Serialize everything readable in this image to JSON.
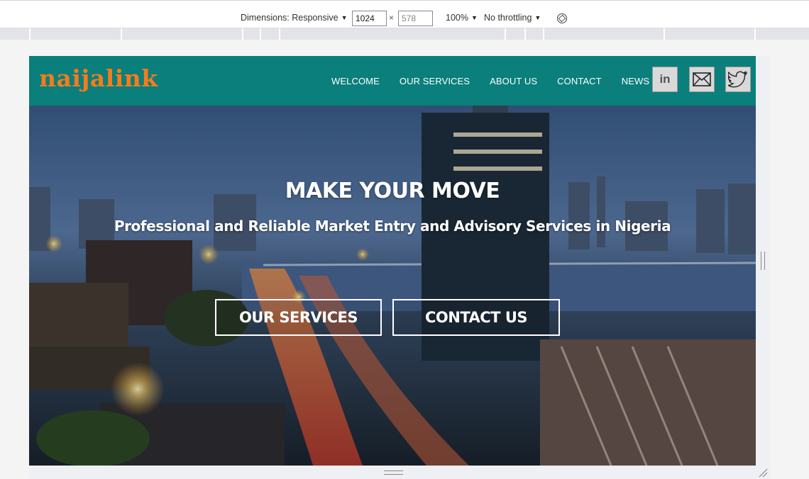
{
  "devtools": {
    "dimensions_label": "Dimensions: Responsive",
    "width_value": "1024",
    "height_value": "578",
    "times": "×",
    "zoom": "100%",
    "throttling": "No throttling",
    "caret": "▼"
  },
  "site": {
    "logo": "naijalink",
    "nav": [
      "WELCOME",
      "OUR SERVICES",
      "ABOUT US",
      "CONTACT",
      "NEWS"
    ],
    "social_icons": [
      "linkedin-icon",
      "email-icon",
      "twitter-icon"
    ],
    "linkedin_label": "in"
  },
  "hero": {
    "title": "MAKE YOUR MOVE",
    "subtitle": "Professional and Reliable Market Entry and Advisory Services in Nigeria",
    "button_services": "OUR SERVICES",
    "button_contact": "CONTACT US"
  },
  "colors": {
    "navbar": "#0b7f7b",
    "logo": "#f47c1c",
    "social_bg": "#d9d9d9"
  }
}
